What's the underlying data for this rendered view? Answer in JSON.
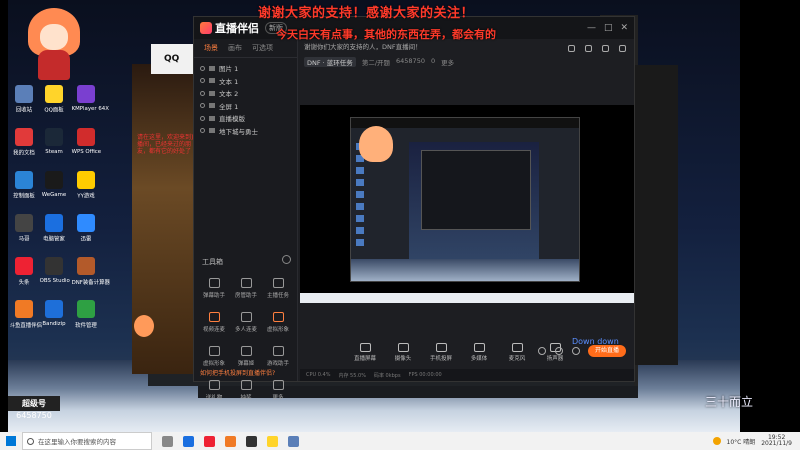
{
  "overlay": {
    "line1": "谢谢大家的支持！感谢大家的关注！",
    "line2": "今天白天有点事，其他的东西在弄，都会有的"
  },
  "desktop_icons": [
    {
      "label": "回收站",
      "color": "#5b7fb8"
    },
    {
      "label": "QQ面板",
      "color": "#ffd42a"
    },
    {
      "label": "KMPlayer 64X",
      "color": "#7a3fd0"
    },
    {
      "label": "我的文档",
      "color": "#e13a3a"
    },
    {
      "label": "Steam",
      "color": "#1b2838"
    },
    {
      "label": "WPS Office",
      "color": "#d12c2c"
    },
    {
      "label": "控制面板",
      "color": "#2b84d6"
    },
    {
      "label": "WeGame",
      "color": "#1a1a1a"
    },
    {
      "label": "YY游戏",
      "color": "#ffcc00"
    },
    {
      "label": "马哥",
      "color": "#444"
    },
    {
      "label": "电脑管家",
      "color": "#1b6fe0"
    },
    {
      "label": "迅雷",
      "color": "#2f8bff"
    },
    {
      "label": "头条",
      "color": "#e23"
    },
    {
      "label": "OBS Studio",
      "color": "#333"
    },
    {
      "label": "DNF装备计算器",
      "color": "#b35a2a"
    },
    {
      "label": "斗鱼直播伴侣",
      "color": "#f07a25"
    },
    {
      "label": "Bandizip",
      "color": "#1e6fd9"
    },
    {
      "label": "软件管理",
      "color": "#2ea043"
    }
  ],
  "bg_window": {
    "qq": "QQ",
    "red_text": "请在这里，欢迎来到直播间，已经来过的朋友，都有它的好处了"
  },
  "app": {
    "name": "直播伴侣",
    "version": "新版",
    "window_controls": [
      "—",
      "□",
      "✕"
    ],
    "tabs": [
      {
        "label": "场景",
        "active": true
      },
      {
        "label": "画布",
        "active": false
      },
      {
        "label": "可选项",
        "active": false
      }
    ],
    "scenes": [
      "图片 1",
      "文本 1",
      "文本 2",
      "全屏 1",
      "直播模版",
      "地下城与勇士"
    ],
    "tools_title": "工具箱",
    "tools": [
      "弹幕助手",
      "房管助手",
      "主播任务",
      "视频连麦",
      "多人连麦",
      "虚拟形象",
      "虚拟形象",
      "弹幕姬",
      "游戏助手",
      "送礼物",
      "抽奖",
      "更多"
    ],
    "tip": "如何把手机投屏到直播伴侣?",
    "room_title": "谢谢你们大家的支持的人，DNF直播间！",
    "room_category": "DNF · 蓝环任务",
    "room_sub": "第二/开题",
    "room_id": "6458750",
    "room_fans": "0",
    "room_extra": "更多",
    "controls": [
      "直播屏幕",
      "摄像头",
      "手机投屏",
      "多媒体",
      "麦克风",
      "扬声器"
    ],
    "down_label": "Down down",
    "go_live": "开始直播",
    "status": [
      "CPU 0.4%",
      "内存 55.0%",
      "码率 0kbps",
      "FPS 00:00:00"
    ]
  },
  "watermark": {
    "label": "超级号",
    "number": "6458750"
  },
  "calligraphy": "三十而立",
  "taskbar": {
    "search_placeholder": "在这里输入你要搜索的内容",
    "apps": [
      "#888",
      "#1b6fe0",
      "#e23",
      "#f07a25",
      "#333",
      "#ffd42a",
      "#5b7fb8"
    ],
    "weather": "10°C 晴朗",
    "time": "19:52",
    "date": "2021/11/9"
  }
}
